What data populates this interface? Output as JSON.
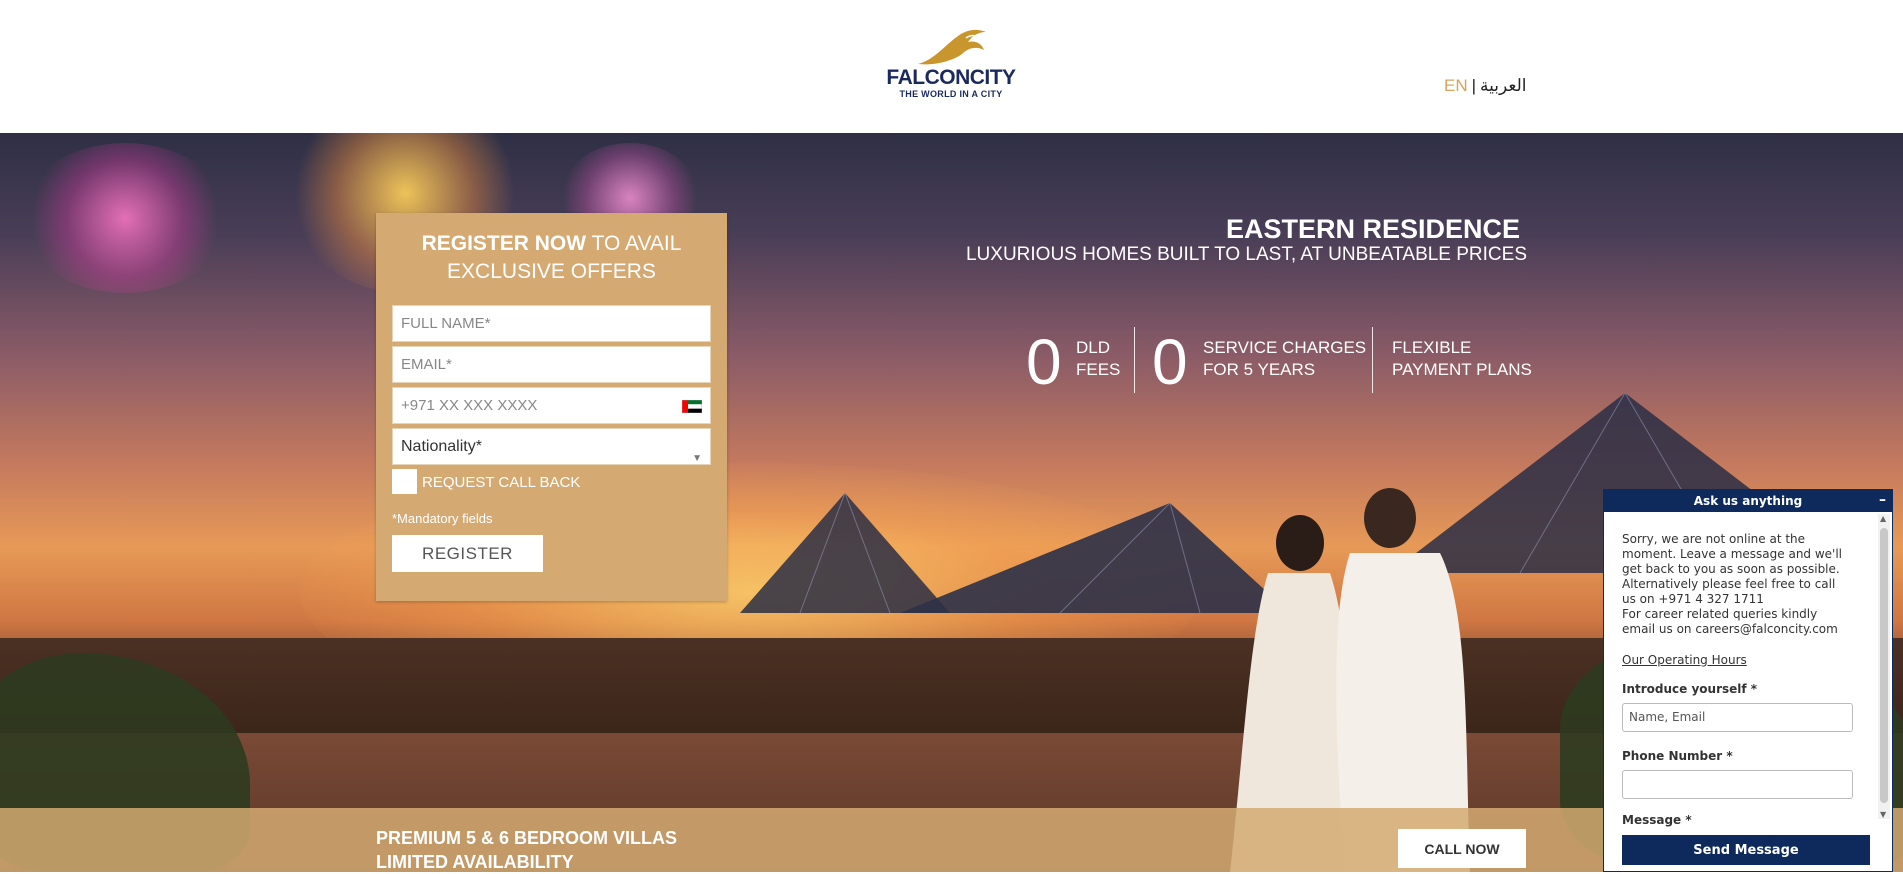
{
  "header": {
    "logo": {
      "name": "FALCONCITY",
      "tagline": "THE WORLD IN A CITY",
      "icon": "falcon-logo-icon"
    },
    "lang": {
      "en": "EN",
      "separator": "|",
      "ar": "العربية"
    }
  },
  "form": {
    "title_bold": "REGISTER NOW",
    "title_rest": " TO AVAIL EXCLUSIVE OFFERS",
    "full_name_placeholder": "FULL NAME*",
    "email_placeholder": "EMAIL*",
    "phone_placeholder": "+971 XX XXX XXXX",
    "phone_flag_icon": "uae-flag-icon",
    "nationality_selected": "Nationality*",
    "callback_label": "REQUEST CALL BACK",
    "mandatory_note": "*Mandatory fields",
    "register_label": "REGISTER"
  },
  "headline": {
    "title": "EASTERN RESIDENCE",
    "subtitle": "LUXURIOUS HOMES BUILT TO LAST, AT UNBEATABLE PRICES",
    "stats": [
      {
        "big": "0",
        "line1": "DLD",
        "line2": "FEES"
      },
      {
        "big": "0",
        "line1": "SERVICE CHARGES",
        "line2": "FOR 5 YEARS"
      },
      {
        "big": "",
        "line1": "FLEXIBLE",
        "line2": "PAYMENT PLANS"
      }
    ]
  },
  "bottom_bar": {
    "line1": "PREMIUM 5 & 6 BEDROOM VILLAS",
    "line2": "LIMITED AVAILABILITY",
    "call_label": "CALL NOW"
  },
  "chat": {
    "title": "Ask us anything",
    "minimize": "–",
    "message_lines": [
      "Sorry, we are not online at the",
      "moment. Leave a message and we'll",
      "get back to you as soon as possible.",
      "Alternatively please feel free to call",
      "us on +971 4 327 1711",
      "For career related queries kindly",
      "email us on careers@falconcity.com"
    ],
    "hours_link": "Our Operating Hours",
    "intro_label": "Introduce yourself *",
    "intro_placeholder": "Name, Email",
    "phone_label": "Phone Number *",
    "message_label": "Message *",
    "send_label": "Send Message"
  },
  "colors": {
    "gold": "#d4aa72",
    "navy": "#0e2a5c",
    "logo_gold": "#c9962e"
  }
}
